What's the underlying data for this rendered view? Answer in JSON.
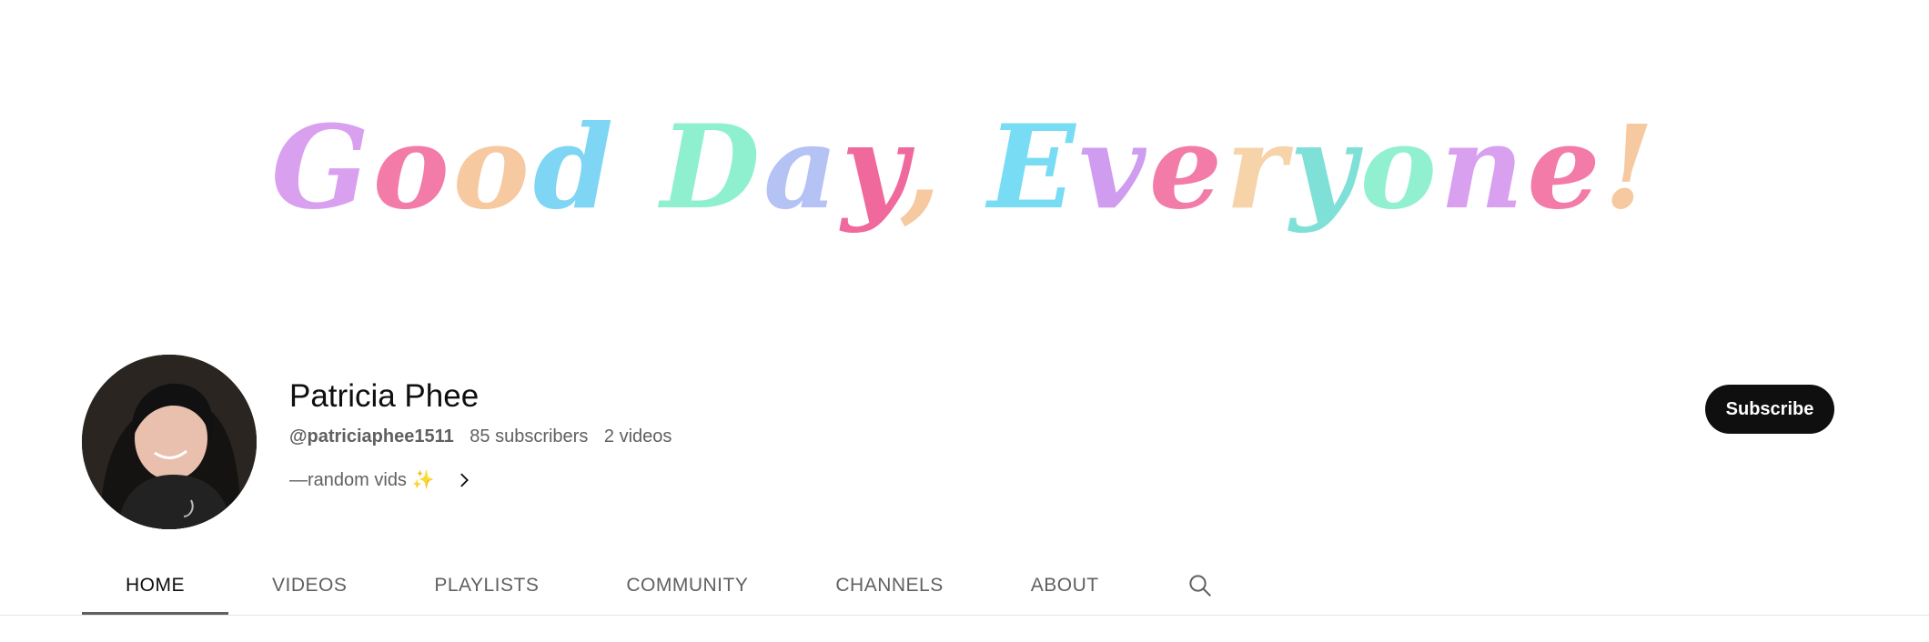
{
  "banner": {
    "text": "Good Day, Everyone!",
    "letter_colors": [
      "#d9a0f0",
      "#f27ba8",
      "#f6c9a0",
      "#7fd6f4",
      "#8ff0cf",
      "#b5c2f4",
      "#f0699c",
      "#f6c9a0",
      "#78dcf4",
      "#cf9cf0",
      "#f27ba8",
      "#f6d3a8",
      "#7fe0d8",
      "#90f0cf",
      "#d9a0f0",
      "#f27ba8",
      "#f6c9a0",
      "#7fd6f4",
      "#f0699c"
    ]
  },
  "channel": {
    "name": "Patricia Phee",
    "handle": "@patriciaphee1511",
    "subscribers": "85 subscribers",
    "videos": "2 videos",
    "description": "—random vids ✨",
    "subscribe_label": "Subscribe"
  },
  "tabs": [
    {
      "label": "HOME",
      "active": true
    },
    {
      "label": "VIDEOS",
      "active": false
    },
    {
      "label": "PLAYLISTS",
      "active": false
    },
    {
      "label": "COMMUNITY",
      "active": false
    },
    {
      "label": "CHANNELS",
      "active": false
    },
    {
      "label": "ABOUT",
      "active": false
    }
  ],
  "icons": {
    "search": "search-icon",
    "chevron": "chevron-right-icon"
  },
  "colors": {
    "primary_text": "#0f0f0f",
    "secondary_text": "#606060",
    "subscribe_bg": "#0f0f0f",
    "divider": "#e5e5e5"
  }
}
